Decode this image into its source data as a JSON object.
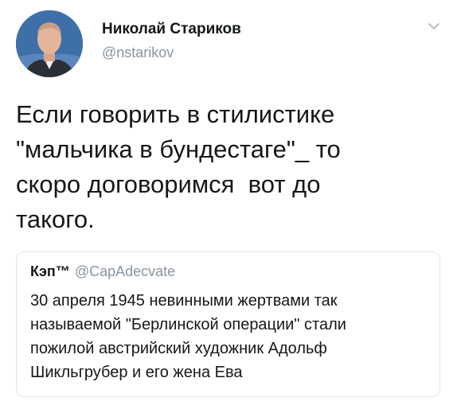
{
  "tweet": {
    "author": {
      "display_name": "Николай Стариков",
      "handle": "@nstarikov",
      "avatar_icon": "avatar-photo-icon"
    },
    "menu_icon": "chevron-down-icon",
    "text": "Если говорить в стилистике\n\"мальчика в бундестаге\"_ то\nскоро договоримся  вот до\nтакого.",
    "quoted": {
      "display_name": "Кэп™",
      "handle": "@CapAdecvate",
      "text": "30 апреля 1945 невинными жертвами так\nназываемой \"Берлинской операции\" стали\nпожилой австрийский художник Адольф\nШикльгрубер и его жена Ева"
    }
  },
  "colors": {
    "text": "#14171a",
    "secondary_text": "#8a949c",
    "border": "#dfe4e8",
    "avatar_background": "#3d6fa8"
  }
}
